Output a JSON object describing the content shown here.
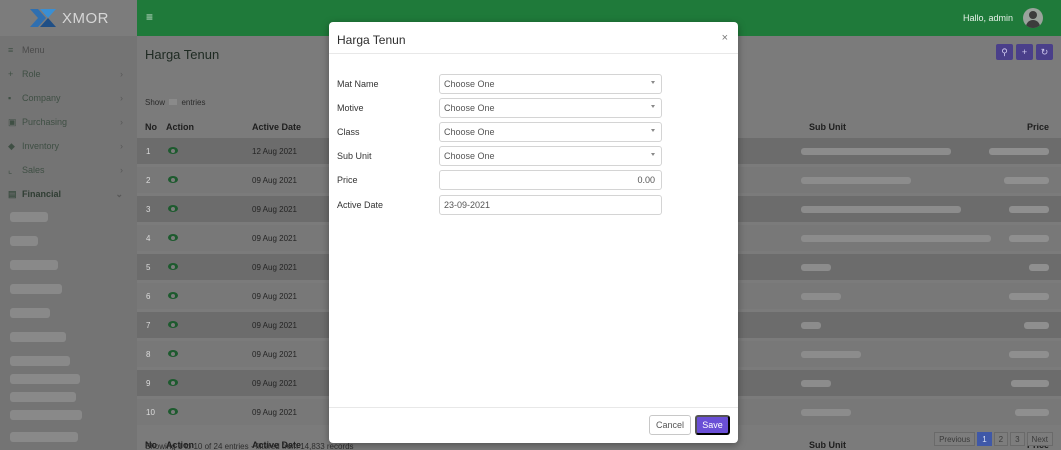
{
  "app": {
    "logo_text": "XMOR",
    "greeting": "Hallo, admin"
  },
  "colors": {
    "topbar": "#1f7a3a",
    "primary_button": "#6a4fd6",
    "action_button": "#4a3f8a",
    "pagination_active": "#3f58a8"
  },
  "sidebar": {
    "items": [
      {
        "label": "Menu",
        "icon": "hamburger-icon"
      },
      {
        "label": "Role",
        "icon": "user-plus-icon"
      },
      {
        "label": "Company",
        "icon": "building-icon"
      },
      {
        "label": "Purchasing",
        "icon": "cart-icon"
      },
      {
        "label": "Inventory",
        "icon": "box-icon"
      },
      {
        "label": "Sales",
        "icon": "chart-icon"
      },
      {
        "label": "Financial",
        "icon": "money-icon"
      }
    ]
  },
  "page": {
    "title": "Harga Tenun",
    "show_label": "Show",
    "entries_label": "entries",
    "footer_info": "Showing 1 to 10 of 24 entries - filtered from 14,833 records",
    "action_icons": [
      "search-icon",
      "plus-icon",
      "refresh-icon"
    ]
  },
  "table": {
    "columns": {
      "no": "No",
      "action": "Action",
      "active_date": "Active Date",
      "sub_unit": "Sub Unit",
      "price": "Price"
    },
    "rows": [
      {
        "no": "1",
        "date": "12 Aug 2021"
      },
      {
        "no": "2",
        "date": "09 Aug 2021"
      },
      {
        "no": "3",
        "date": "09 Aug 2021"
      },
      {
        "no": "4",
        "date": "09 Aug 2021"
      },
      {
        "no": "5",
        "date": "09 Aug 2021"
      },
      {
        "no": "6",
        "date": "09 Aug 2021"
      },
      {
        "no": "7",
        "date": "09 Aug 2021"
      },
      {
        "no": "8",
        "date": "09 Aug 2021"
      },
      {
        "no": "9",
        "date": "09 Aug 2021"
      },
      {
        "no": "10",
        "date": "09 Aug 2021"
      }
    ]
  },
  "pagination": {
    "previous": "Previous",
    "pages": [
      "1",
      "2",
      "3"
    ],
    "next": "Next",
    "current": "1"
  },
  "modal": {
    "title": "Harga Tenun",
    "close_icon": "close-icon",
    "fields": {
      "mat_name": {
        "label": "Mat Name",
        "value": "Choose One"
      },
      "motive": {
        "label": "Motive",
        "value": "Choose One"
      },
      "class": {
        "label": "Class",
        "value": "Choose One"
      },
      "sub_unit": {
        "label": "Sub Unit",
        "value": "Choose One"
      },
      "price": {
        "label": "Price",
        "value": "0.00"
      },
      "active_date": {
        "label": "Active Date",
        "value": "23-09-2021"
      }
    },
    "cancel_label": "Cancel",
    "save_label": "Save"
  }
}
